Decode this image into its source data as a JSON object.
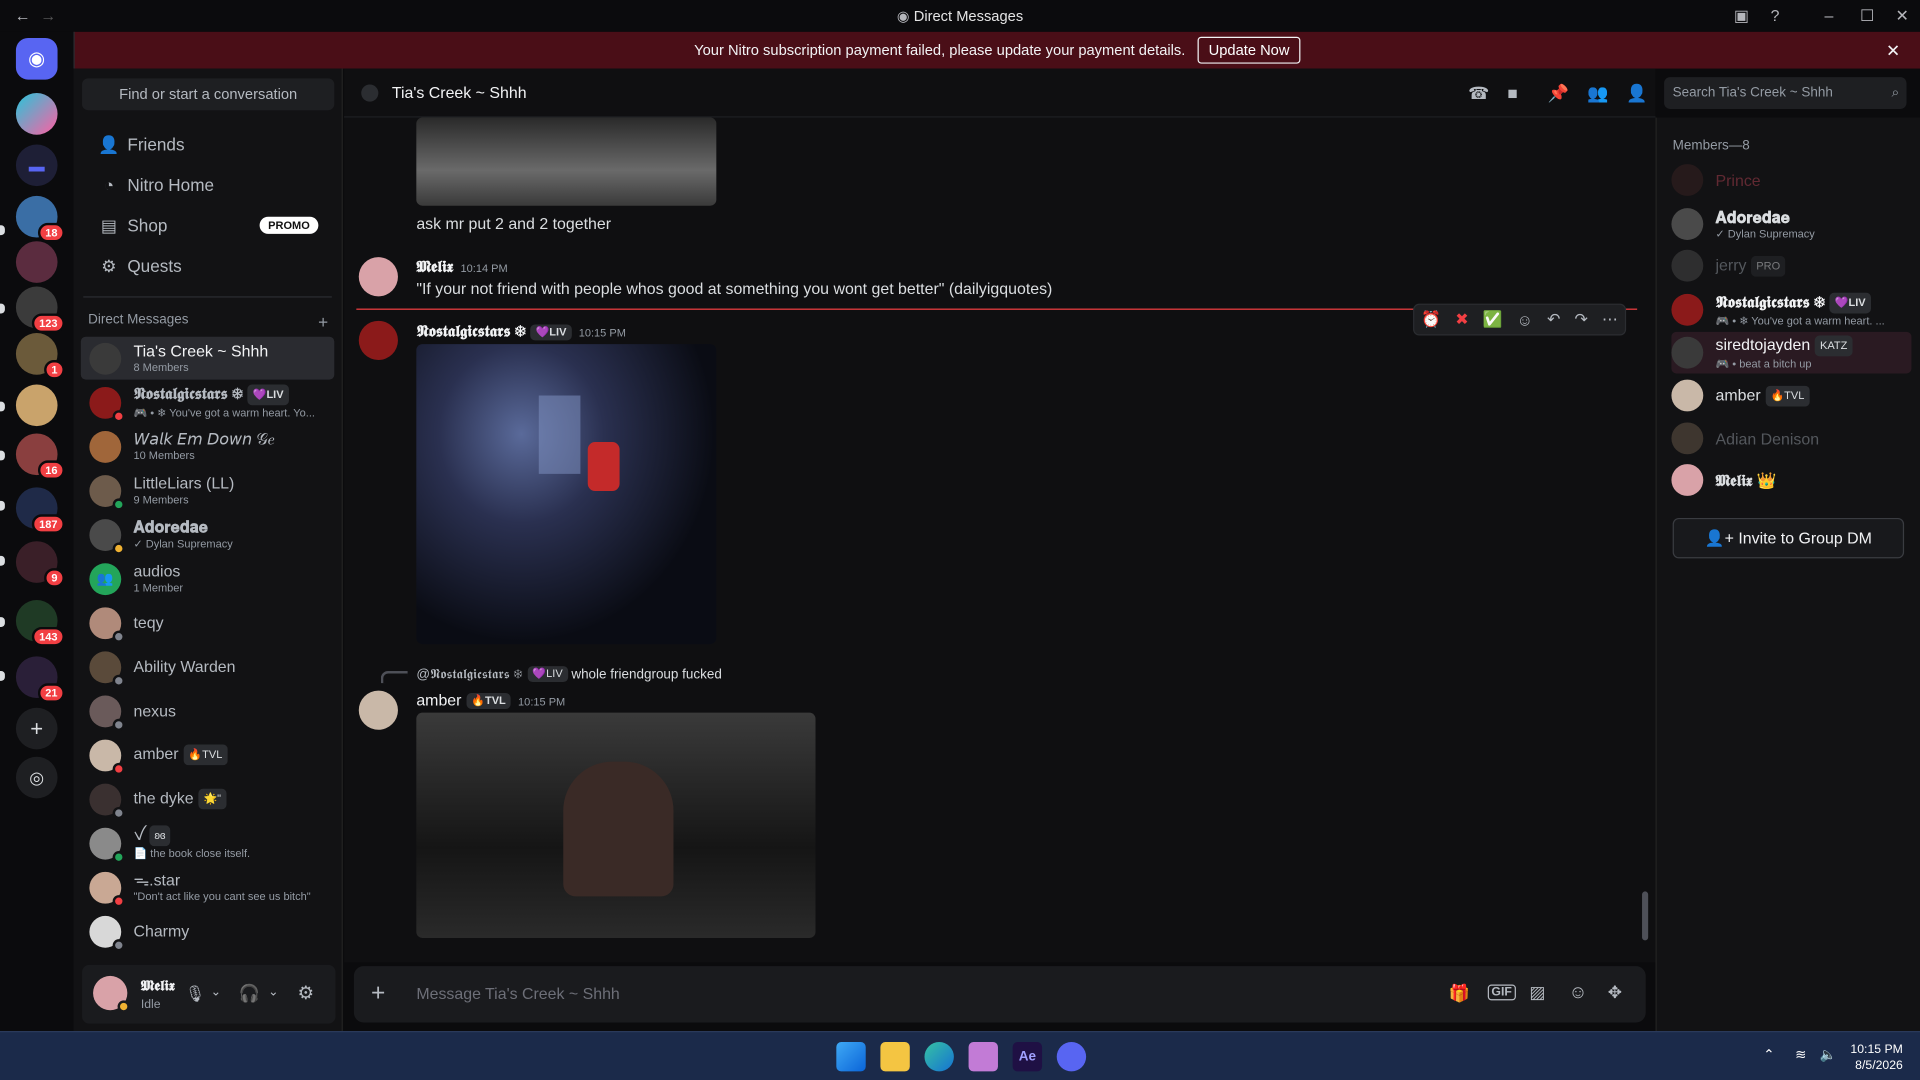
{
  "window": {
    "title": "Direct Messages"
  },
  "banner": {
    "text": "Your Nitro subscription payment failed, please update your payment details.",
    "button": "Update Now"
  },
  "rail": {
    "badges": [
      "18",
      "123",
      "1",
      "16",
      "187",
      "9",
      "143",
      "21"
    ]
  },
  "sidebar": {
    "find": "Find or start a conversation",
    "nav": [
      {
        "icon": "friends-icon",
        "label": "Friends"
      },
      {
        "icon": "nitro-icon",
        "label": "Nitro Home"
      },
      {
        "icon": "shop-icon",
        "label": "Shop"
      },
      {
        "icon": "quests-icon",
        "label": "Quests"
      }
    ],
    "promo": "PROMO",
    "dm_header": "Direct Messages",
    "dms": [
      {
        "name": "Tia's Creek ~ Shhh",
        "sub": "8 Members"
      },
      {
        "name": "𝕹𝖔𝖘𝖙𝖆𝖑𝖌𝖎𝖈𝖘𝖙𝖆𝖗𝖘 ❄",
        "tag": "💜LIV",
        "sub": "🎮 • ❄ You've got a warm heart. Yo..."
      },
      {
        "name": "𝘞𝘢𝘭𝘬 𝘌𝘮 𝘋𝘰𝘸𝘯 𝒢𝑒",
        "sub": "10 Members"
      },
      {
        "name": "LittleLiars (LL)",
        "sub": "9 Members"
      },
      {
        "name": "𝐀𝐝𝐨𝐫𝐞𝐝𝐚𝐞",
        "sub": "✓ Dylan Supremacy"
      },
      {
        "name": "audios",
        "sub": "1 Member"
      },
      {
        "name": "teqy",
        "sub": ""
      },
      {
        "name": "Ability Warden",
        "sub": ""
      },
      {
        "name": "nexus",
        "sub": ""
      },
      {
        "name": "amber",
        "tag": "🔥TVL",
        "sub": ""
      },
      {
        "name": "the dyke",
        "tag": "🌟\"",
        "sub": ""
      },
      {
        "name": "ꪜ",
        "tag": "ʚɞ",
        "sub": "📄 the book close itself."
      },
      {
        "name": "ᯓ.star",
        "sub": "\"Don't act like you cant see us bitch\""
      },
      {
        "name": "Charmy",
        "sub": ""
      }
    ]
  },
  "user": {
    "name": "𝕸𝖊𝖑𝖎𝖝",
    "status": "Idle"
  },
  "chat": {
    "channel": "Tia's Creek ~ Shhh",
    "search_placeholder": "Search Tia's Creek ~ Shhh",
    "composer_placeholder": "Message Tia's Creek ~ Shhh",
    "messages": [
      {
        "text": "ask mr put 2 and 2 together"
      },
      {
        "author": "𝕸𝖊𝖑𝖎𝖝",
        "time": "10:14 PM",
        "text": "\"If your not friend with people whos good at something you wont get better\" (dailyigquotes)"
      },
      {
        "author": "𝕹𝖔𝖘𝖙𝖆𝖑𝖌𝖎𝖈𝖘𝖙𝖆𝖗𝖘 ❄",
        "tag": "💜LIV",
        "time": "10:15 PM"
      },
      {
        "reply_author": "@𝕹𝖔𝖘𝖙𝖆𝖑𝖌𝖎𝖈𝖘𝖙𝖆𝖗𝖘 ❄",
        "reply_tag": "💜LIV",
        "reply_text": "whole friendgroup fucked",
        "author": "amber",
        "tag": "🔥TVL",
        "time": "10:15 PM"
      }
    ]
  },
  "members": {
    "header": "Members—8",
    "list": [
      {
        "name": "Prince",
        "color": "#7a2a3a",
        "sub": ""
      },
      {
        "name": "𝐀𝐝𝐨𝐫𝐞𝐝𝐚𝐞",
        "color": "#dbdee1",
        "sub": "✓ Dylan Supremacy"
      },
      {
        "name": "jerry",
        "color": "#5c5f66",
        "tag": "PRO",
        "sub": ""
      },
      {
        "name": "𝕹𝖔𝖘𝖙𝖆𝖑𝖌𝖎𝖈𝖘𝖙𝖆𝖗𝖘 ❄",
        "color": "#f2f3f5",
        "tag": "💜LIV",
        "sub": "🎮 • ❄ You've got a warm heart. ..."
      },
      {
        "name": "siredtojayden",
        "color": "#f2f3f5",
        "tag": "KATZ",
        "sub": "🎮 • beat a bitch up"
      },
      {
        "name": "amber",
        "color": "#dbdee1",
        "tag": "🔥TVL",
        "sub": ""
      },
      {
        "name": "Adian Denison",
        "color": "#5c5f66",
        "sub": ""
      },
      {
        "name": "𝕸𝖊𝖑𝖎𝖝 👑",
        "color": "#dbdee1",
        "sub": ""
      }
    ],
    "invite": "Invite to Group DM"
  },
  "taskbar": {
    "time": "10:15 PM",
    "date": "8/5/2026"
  }
}
